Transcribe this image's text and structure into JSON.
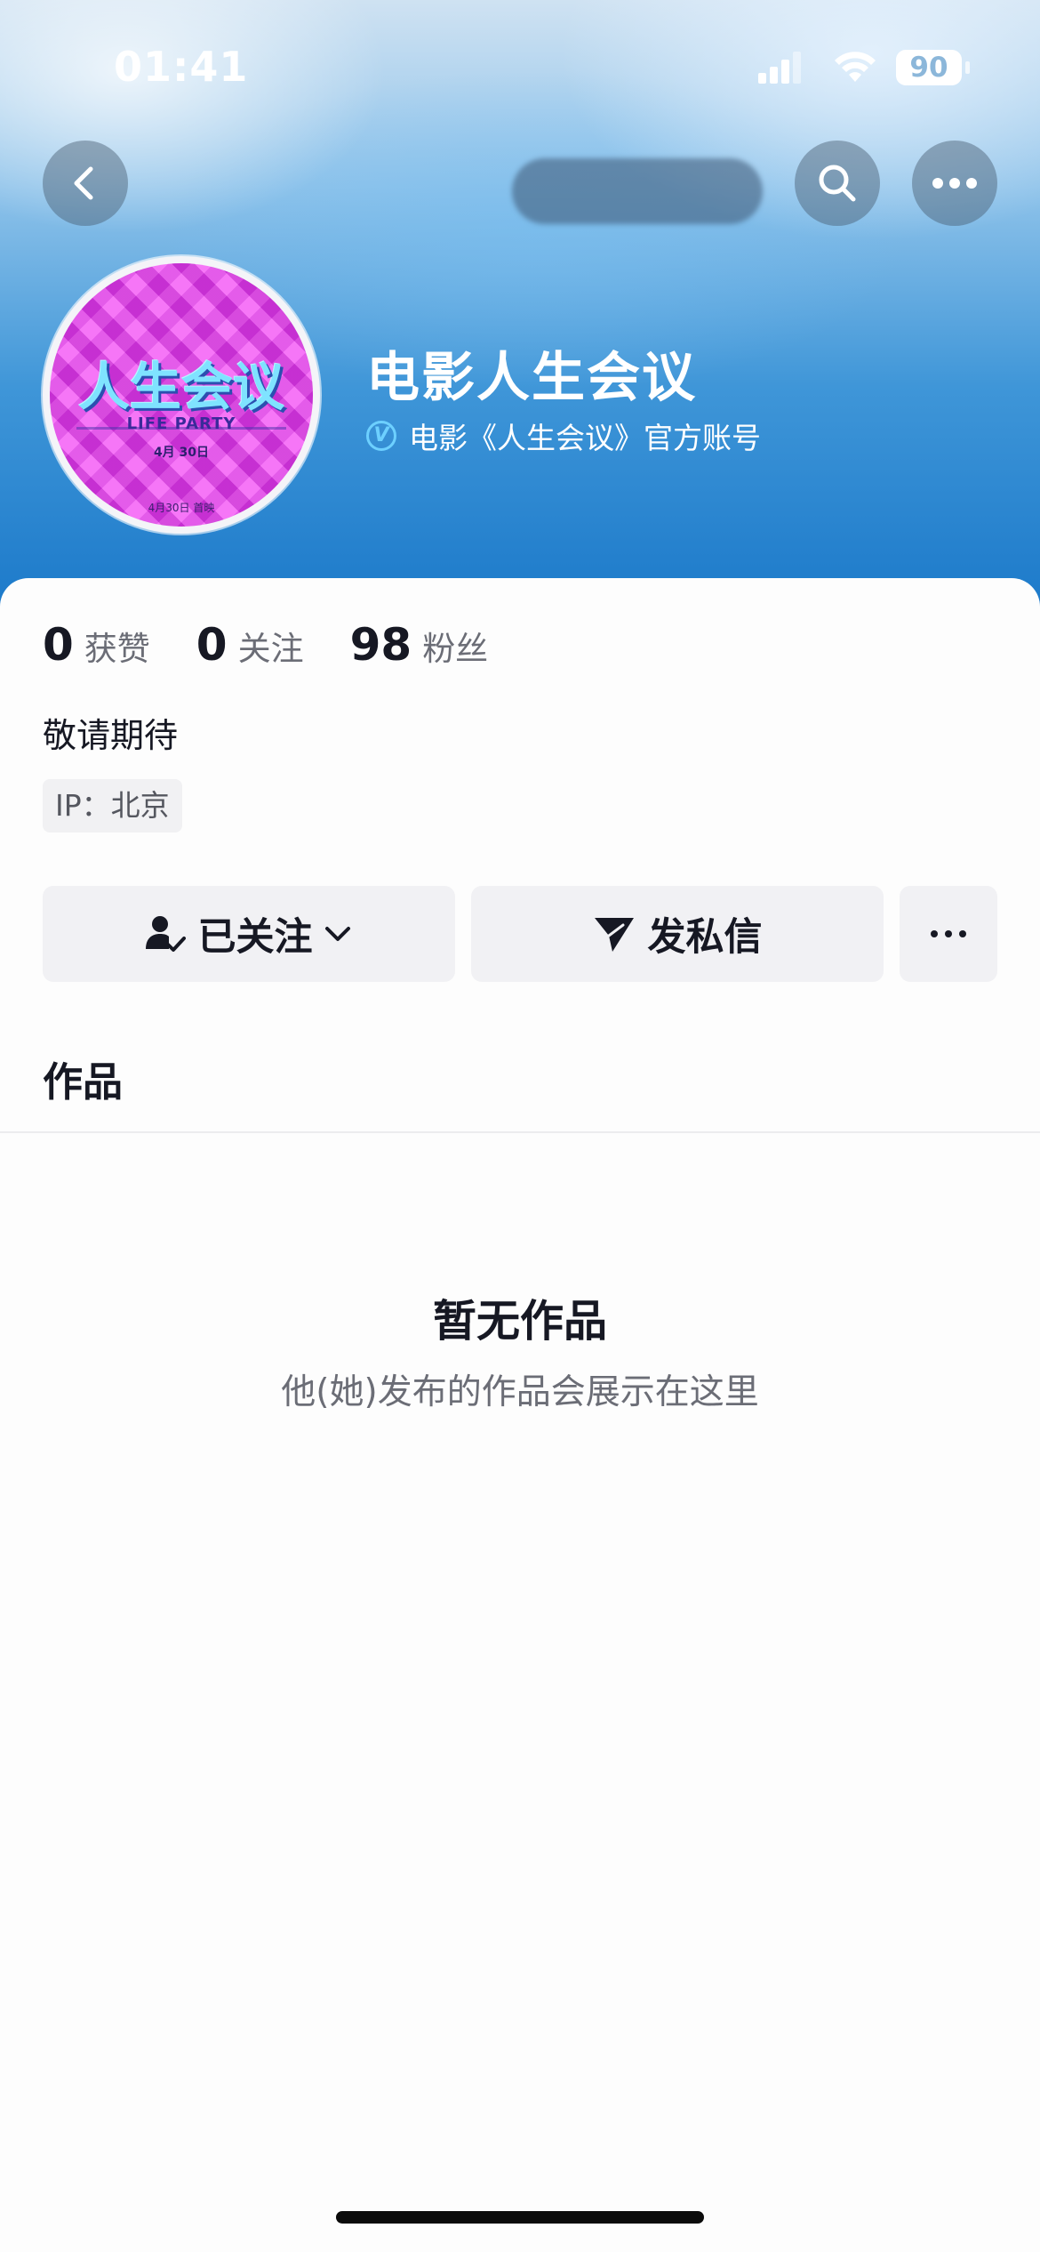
{
  "status_bar": {
    "time": "01:41",
    "battery": "90"
  },
  "nav": {
    "back_icon": "chevron-left-icon",
    "search_icon": "search-icon",
    "more_icon": "more-horizontal-icon"
  },
  "profile": {
    "name": "电影人生会议",
    "verified_text": "电影《人生会议》官方账号",
    "avatar": {
      "title": "人生会议",
      "subtitle": "LIFE PARTY",
      "date": "4月 30日",
      "footer": "4月30日 首映"
    }
  },
  "stats": [
    {
      "value": "0",
      "label": "获赞"
    },
    {
      "value": "0",
      "label": "关注"
    },
    {
      "value": "98",
      "label": "粉丝"
    }
  ],
  "bio": "敬请期待",
  "ip": "IP：北京",
  "actions": {
    "follow_label": "已关注",
    "message_label": "发私信"
  },
  "tabs": {
    "works_label": "作品"
  },
  "empty_state": {
    "title": "暂无作品",
    "subtitle": "他(她)发布的作品会展示在这里"
  },
  "colors": {
    "header_gradient_top": "#cfe2f2",
    "header_gradient_bottom": "#1a78c9",
    "verified_accent": "#6dd0ff",
    "text_primary": "#161823",
    "text_secondary": "#6b6d76",
    "button_bg": "#f1f1f4"
  }
}
